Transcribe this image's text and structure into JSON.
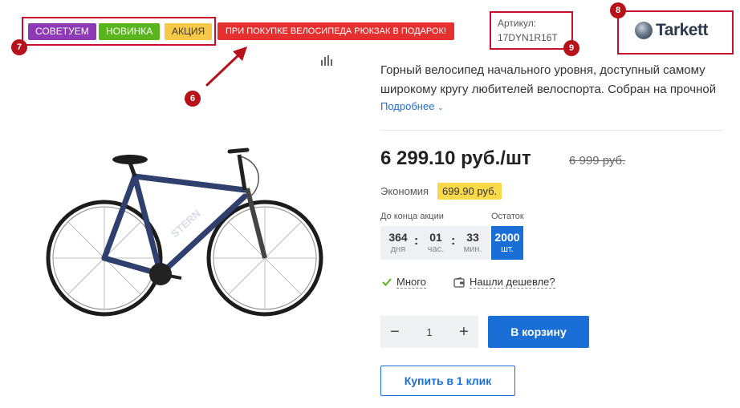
{
  "badges": {
    "recommend": "СОВЕТУЕМ",
    "new": "НОВИНКА",
    "sale": "АКЦИЯ",
    "promo": "ПРИ ПОКУПКЕ ВЕЛОСИПЕДА РЮКЗАК В ПОДАРОК!"
  },
  "sku": {
    "label": "Артикул:",
    "value": "17DYN1R16T"
  },
  "brand": {
    "name": "Tarkett"
  },
  "description": {
    "text": "Горный велосипед начального уровня, доступный самому широкому кругу любителей велоспорта. Собран на прочной",
    "more_link": "Подробнее"
  },
  "price": {
    "current": "6 299.10 руб./шт",
    "old": "6 999 руб.",
    "savings_label": "Экономия",
    "savings_value": "699.90 руб."
  },
  "timer": {
    "label": "До конца акции",
    "days": "364",
    "days_unit": "дня",
    "hours": "01",
    "hours_unit": "час.",
    "minutes": "33",
    "minutes_unit": "мин.",
    "separator": ":"
  },
  "stock": {
    "label": "Остаток",
    "value": "2000",
    "unit": "шт."
  },
  "availability": {
    "text": "Много",
    "cheaper_link": "Нашли дешевле?"
  },
  "quantity": {
    "minus": "−",
    "value": "1",
    "plus": "+"
  },
  "buttons": {
    "add_to_cart": "В корзину",
    "buy_one_click": "Купить в 1 клик"
  },
  "markers": {
    "m6": "6",
    "m7": "7",
    "m8": "8",
    "m9": "9"
  },
  "colors": {
    "accent_blue": "#1a6fd6",
    "annotation_red": "#c8102e",
    "badge_purple": "#8e3ab5",
    "badge_green": "#5ab51d",
    "badge_yellow": "#f7c948",
    "promo_red": "#e5302f"
  }
}
